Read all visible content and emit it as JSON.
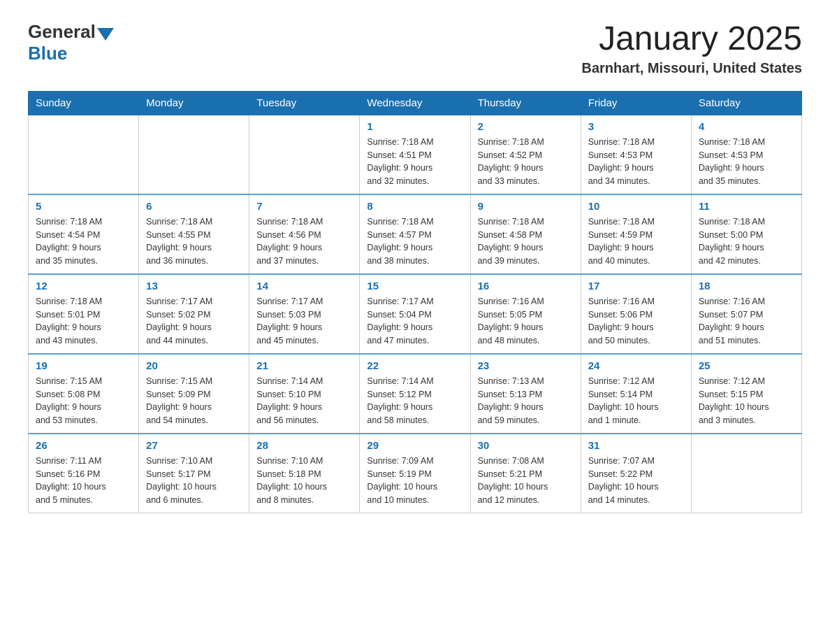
{
  "header": {
    "month_title": "January 2025",
    "location": "Barnhart, Missouri, United States",
    "logo_general": "General",
    "logo_blue": "Blue"
  },
  "days_of_week": [
    "Sunday",
    "Monday",
    "Tuesday",
    "Wednesday",
    "Thursday",
    "Friday",
    "Saturday"
  ],
  "weeks": [
    [
      {
        "day": "",
        "info": ""
      },
      {
        "day": "",
        "info": ""
      },
      {
        "day": "",
        "info": ""
      },
      {
        "day": "1",
        "info": "Sunrise: 7:18 AM\nSunset: 4:51 PM\nDaylight: 9 hours\nand 32 minutes."
      },
      {
        "day": "2",
        "info": "Sunrise: 7:18 AM\nSunset: 4:52 PM\nDaylight: 9 hours\nand 33 minutes."
      },
      {
        "day": "3",
        "info": "Sunrise: 7:18 AM\nSunset: 4:53 PM\nDaylight: 9 hours\nand 34 minutes."
      },
      {
        "day": "4",
        "info": "Sunrise: 7:18 AM\nSunset: 4:53 PM\nDaylight: 9 hours\nand 35 minutes."
      }
    ],
    [
      {
        "day": "5",
        "info": "Sunrise: 7:18 AM\nSunset: 4:54 PM\nDaylight: 9 hours\nand 35 minutes."
      },
      {
        "day": "6",
        "info": "Sunrise: 7:18 AM\nSunset: 4:55 PM\nDaylight: 9 hours\nand 36 minutes."
      },
      {
        "day": "7",
        "info": "Sunrise: 7:18 AM\nSunset: 4:56 PM\nDaylight: 9 hours\nand 37 minutes."
      },
      {
        "day": "8",
        "info": "Sunrise: 7:18 AM\nSunset: 4:57 PM\nDaylight: 9 hours\nand 38 minutes."
      },
      {
        "day": "9",
        "info": "Sunrise: 7:18 AM\nSunset: 4:58 PM\nDaylight: 9 hours\nand 39 minutes."
      },
      {
        "day": "10",
        "info": "Sunrise: 7:18 AM\nSunset: 4:59 PM\nDaylight: 9 hours\nand 40 minutes."
      },
      {
        "day": "11",
        "info": "Sunrise: 7:18 AM\nSunset: 5:00 PM\nDaylight: 9 hours\nand 42 minutes."
      }
    ],
    [
      {
        "day": "12",
        "info": "Sunrise: 7:18 AM\nSunset: 5:01 PM\nDaylight: 9 hours\nand 43 minutes."
      },
      {
        "day": "13",
        "info": "Sunrise: 7:17 AM\nSunset: 5:02 PM\nDaylight: 9 hours\nand 44 minutes."
      },
      {
        "day": "14",
        "info": "Sunrise: 7:17 AM\nSunset: 5:03 PM\nDaylight: 9 hours\nand 45 minutes."
      },
      {
        "day": "15",
        "info": "Sunrise: 7:17 AM\nSunset: 5:04 PM\nDaylight: 9 hours\nand 47 minutes."
      },
      {
        "day": "16",
        "info": "Sunrise: 7:16 AM\nSunset: 5:05 PM\nDaylight: 9 hours\nand 48 minutes."
      },
      {
        "day": "17",
        "info": "Sunrise: 7:16 AM\nSunset: 5:06 PM\nDaylight: 9 hours\nand 50 minutes."
      },
      {
        "day": "18",
        "info": "Sunrise: 7:16 AM\nSunset: 5:07 PM\nDaylight: 9 hours\nand 51 minutes."
      }
    ],
    [
      {
        "day": "19",
        "info": "Sunrise: 7:15 AM\nSunset: 5:08 PM\nDaylight: 9 hours\nand 53 minutes."
      },
      {
        "day": "20",
        "info": "Sunrise: 7:15 AM\nSunset: 5:09 PM\nDaylight: 9 hours\nand 54 minutes."
      },
      {
        "day": "21",
        "info": "Sunrise: 7:14 AM\nSunset: 5:10 PM\nDaylight: 9 hours\nand 56 minutes."
      },
      {
        "day": "22",
        "info": "Sunrise: 7:14 AM\nSunset: 5:12 PM\nDaylight: 9 hours\nand 58 minutes."
      },
      {
        "day": "23",
        "info": "Sunrise: 7:13 AM\nSunset: 5:13 PM\nDaylight: 9 hours\nand 59 minutes."
      },
      {
        "day": "24",
        "info": "Sunrise: 7:12 AM\nSunset: 5:14 PM\nDaylight: 10 hours\nand 1 minute."
      },
      {
        "day": "25",
        "info": "Sunrise: 7:12 AM\nSunset: 5:15 PM\nDaylight: 10 hours\nand 3 minutes."
      }
    ],
    [
      {
        "day": "26",
        "info": "Sunrise: 7:11 AM\nSunset: 5:16 PM\nDaylight: 10 hours\nand 5 minutes."
      },
      {
        "day": "27",
        "info": "Sunrise: 7:10 AM\nSunset: 5:17 PM\nDaylight: 10 hours\nand 6 minutes."
      },
      {
        "day": "28",
        "info": "Sunrise: 7:10 AM\nSunset: 5:18 PM\nDaylight: 10 hours\nand 8 minutes."
      },
      {
        "day": "29",
        "info": "Sunrise: 7:09 AM\nSunset: 5:19 PM\nDaylight: 10 hours\nand 10 minutes."
      },
      {
        "day": "30",
        "info": "Sunrise: 7:08 AM\nSunset: 5:21 PM\nDaylight: 10 hours\nand 12 minutes."
      },
      {
        "day": "31",
        "info": "Sunrise: 7:07 AM\nSunset: 5:22 PM\nDaylight: 10 hours\nand 14 minutes."
      },
      {
        "day": "",
        "info": ""
      }
    ]
  ]
}
